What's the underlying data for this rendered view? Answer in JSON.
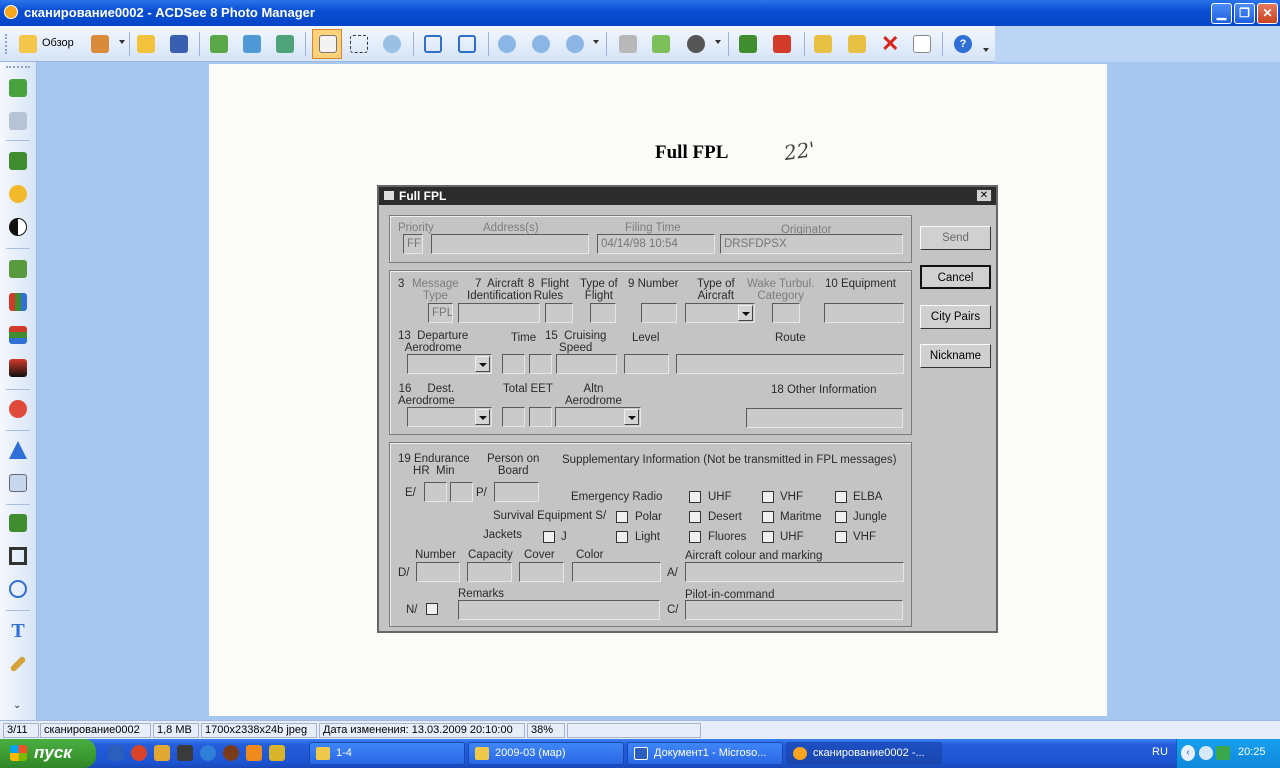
{
  "window": {
    "title": "сканирование0002 - ACDSee 8 Photo Manager"
  },
  "toolbar": {
    "browse_label": "Обзор"
  },
  "document": {
    "heading": "Full FPL",
    "handwriting": "22'",
    "dialog": {
      "title": "Full FPL",
      "close_glyph": "✕",
      "header": {
        "priority_label": "Priority",
        "priority_value": "FF",
        "address_label": "Address(s)",
        "filing_time_label": "Filing Time",
        "filing_time_value": "04/14/98 10:54",
        "originator_label": "Originator",
        "originator_value": "DRSFDPSX"
      },
      "section1": {
        "item3_num": "3",
        "message_type_label": "Message\nType",
        "message_type_value": "FPL",
        "item7_label": "7  Aircraft\nIdentification",
        "item8_label": "8  Flight\nRules",
        "flight_type_label": "Type of\nFlight",
        "item9_label": "9  Number",
        "aircraft_type_label": "Type of\nAircraft",
        "wake_label": "Wake Turbul.\nCategory",
        "item10_label": "10 Equipment",
        "item13_label": "13  Departure\nAerodrome",
        "time_label": "Time",
        "item15_label": "15  Cruising\nSpeed",
        "level_label": "Level",
        "route_label": "Route",
        "item16_label": "16     Dest.\nAerodrome",
        "total_eet_label": "Total EET",
        "altn_label": "Altn\nAerodrome",
        "item18_label": "18  Other Information"
      },
      "section2": {
        "item19_label": "19 Endurance\nHR  Min",
        "person_label": "Person on\nBoard",
        "supp_label": "Supplementary Information (Not be transmitted in FPL messages)",
        "e_prefix": "E/",
        "p_prefix": "P/",
        "emergency_radio_label": "Emergency Radio",
        "radio_uhf": "UHF",
        "radio_vhf": "VHF",
        "radio_elba": "ELBA",
        "survival_label": "Survival Equipment S/",
        "surv_polar": "Polar",
        "surv_desert": "Desert",
        "surv_maritme": "Maritme",
        "surv_jungle": "Jungle",
        "jackets_label": "Jackets",
        "jack_j": "J",
        "jack_light": "Light",
        "jack_fluores": "Fluores",
        "jack_uhf": "UHF",
        "jack_vhf": "VHF",
        "number_label": "Number",
        "capacity_label": "Capacity",
        "cover_label": "Cover",
        "color_label": "Color",
        "colour_marking_label": "Aircraft colour and marking",
        "d_prefix": "D/",
        "a_prefix": "A/",
        "remarks_label": "Remarks",
        "pic_label": "Pilot-in-command",
        "n_prefix": "N/",
        "c_prefix": "C/"
      },
      "buttons": {
        "send": "Send",
        "cancel": "Cancel",
        "city_pairs": "City Pairs",
        "nickname": "Nickname"
      }
    }
  },
  "statusbar": {
    "index": "3/11",
    "filename": "сканирование0002",
    "size": "1,8 MB",
    "dimensions": "1700x2338x24b jpeg",
    "modified": "Дата изменения: 13.03.2009 20:10:00",
    "zoom": "38%"
  },
  "taskbar": {
    "start_label": "пуск",
    "tasks": [
      {
        "label": "1-4"
      },
      {
        "label": "2009-03 (мар)"
      },
      {
        "label": "Документ1 - Microso..."
      },
      {
        "label": "сканирование0002 -..."
      }
    ],
    "language": "RU",
    "clock": "20:25"
  },
  "colors": {
    "titlebar": "#0a4fd4",
    "viewer_bg": "#a6c8f0",
    "taskbar": "#245ddb",
    "start_button": "#3a9a30"
  }
}
